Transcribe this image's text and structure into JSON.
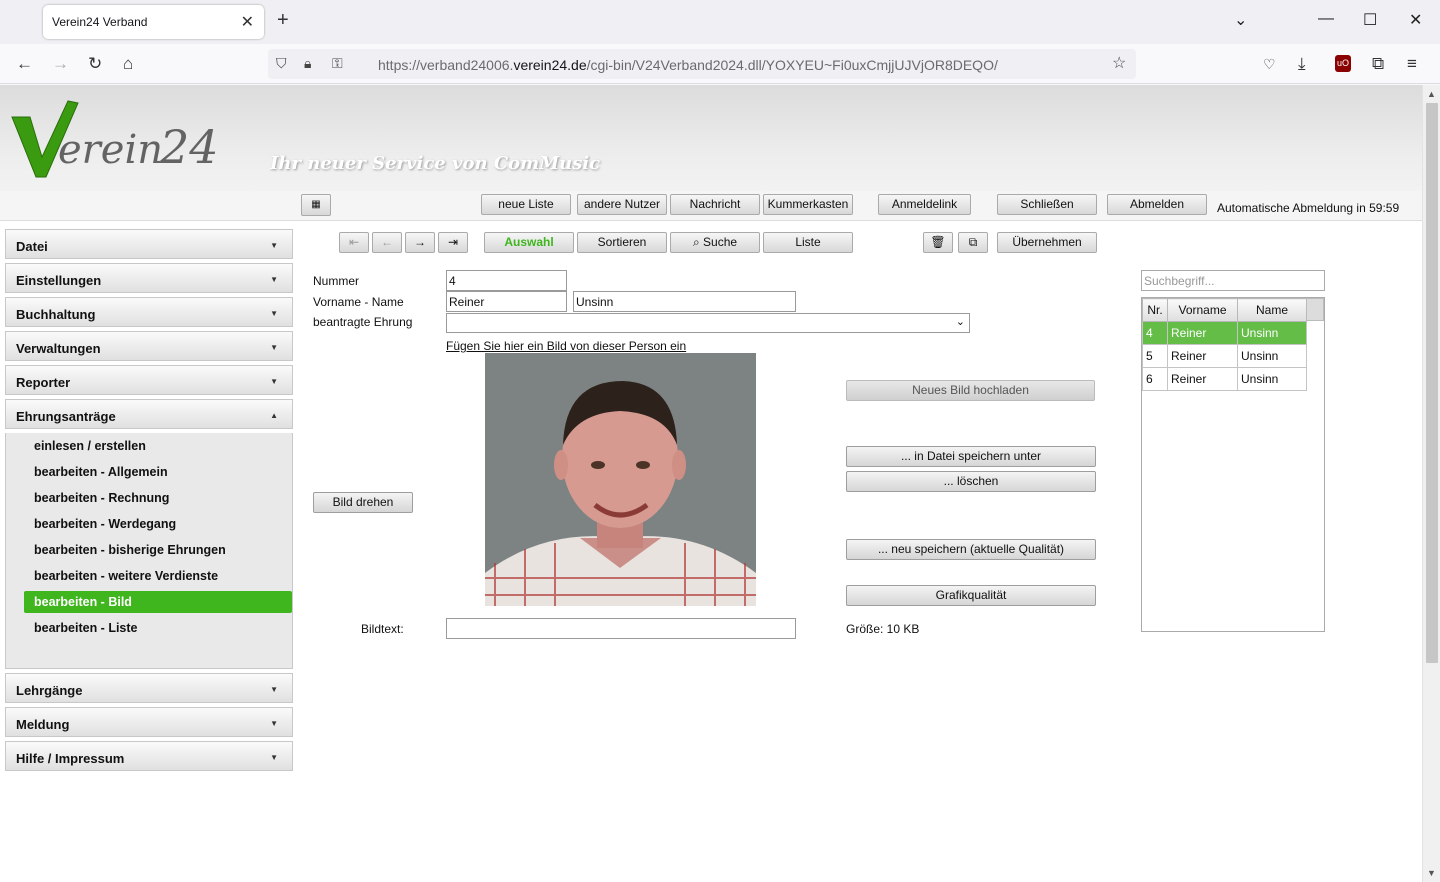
{
  "browser": {
    "tab_title": "Verein24 Verband",
    "url_prefix": "https://verband24006.",
    "url_domain": "verein24.de",
    "url_path": "/cgi-bin/V24Verband2024.dll/YOXYEU~Fi0uxCmjjUJVjOR8DEQO/"
  },
  "banner": {
    "logo_text": "Verein 24",
    "tagline": "Ihr neuer Service von ComMusic"
  },
  "toolbar": {
    "buttons": [
      "neue Liste",
      "andere Nutzer",
      "Nachricht",
      "Kummerkasten",
      "Anmeldelink",
      "Schließen",
      "Abmelden"
    ],
    "auto_logout": "Automatische Abmeldung in 59:59"
  },
  "actions": {
    "auswahl": "Auswahl",
    "sortieren": "Sortieren",
    "suche": "Suche",
    "liste": "Liste",
    "uebernehmen": "Übernehmen"
  },
  "sidebar": {
    "sections_top": [
      "Datei",
      "Einstellungen",
      "Buchhaltung",
      "Verwaltungen",
      "Reporter"
    ],
    "open_section": "Ehrungsanträge",
    "subitems": [
      "einlesen / erstellen",
      "bearbeiten - Allgemein",
      "bearbeiten - Rechnung",
      "bearbeiten - Werdegang",
      "bearbeiten - bisherige Ehrungen",
      "bearbeiten - weitere Verdienste",
      "bearbeiten - Bild",
      "bearbeiten - Liste"
    ],
    "sections_bottom": [
      "Lehrgänge",
      "Meldung",
      "Hilfe / Impressum"
    ]
  },
  "form": {
    "nummer_label": "Nummer",
    "nummer_value": "4",
    "name_label": "Vorname - Name",
    "vorname_value": "Reiner",
    "nachname_value": "Unsinn",
    "ehrung_label": "beantragte Ehrung",
    "ehrung_value": "",
    "image_link": "Fügen Sie hier ein Bild von dieser Person ein",
    "rotate_button": "Bild drehen",
    "bildtext_label": "Bildtext:",
    "bildtext_value": "",
    "upload_button": "Neues Bild hochladen",
    "save_as_button": "... in Datei speichern unter",
    "delete_button": "... löschen",
    "resave_button": "... neu speichern (aktuelle Qualität)",
    "quality_button": "Grafikqualität",
    "size_text": "Größe: 10 KB"
  },
  "list": {
    "search_placeholder": "Suchbegriff...",
    "columns": [
      "Nr.",
      "Vorname",
      "Name"
    ],
    "rows": [
      [
        "4",
        "Reiner",
        "Unsinn"
      ],
      [
        "5",
        "Reiner",
        "Unsinn"
      ],
      [
        "6",
        "Reiner",
        "Unsinn"
      ]
    ]
  },
  "colors": {
    "accent_green": "#3fb51e",
    "selected_row": "#63bd46"
  }
}
